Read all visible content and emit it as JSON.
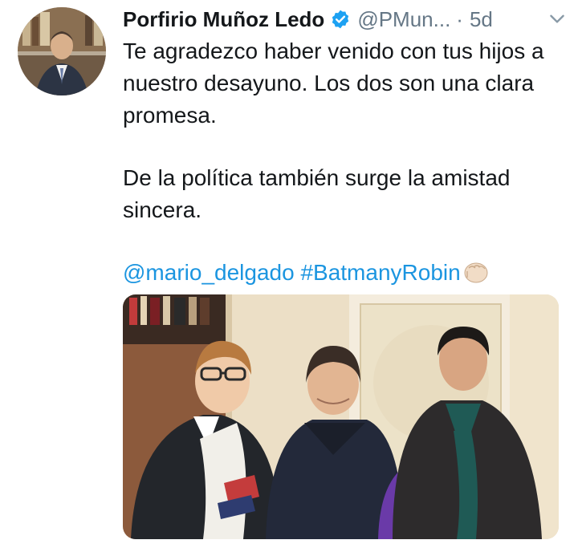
{
  "tweet": {
    "author": {
      "name": "Porfirio Muñoz Ledo",
      "handle": "@PMun...",
      "verified": true
    },
    "separator": "·",
    "time": "5d",
    "text": {
      "line1": "Te agradezco haber venido con tus hijos a nuestro desayuno. Los dos son una clara promesa.",
      "line2": "De la política también surge la amistad sincera.",
      "mention": "@mario_delgado",
      "hashtag": "#BatmanyRobin"
    },
    "icons": {
      "verified": "verified-badge-icon",
      "menu": "chevron-down-icon",
      "emoji": "fist-bump-emoji"
    },
    "colors": {
      "link": "#1b95e0",
      "secondary_text": "#657786",
      "verified": "#1da1f2"
    }
  }
}
